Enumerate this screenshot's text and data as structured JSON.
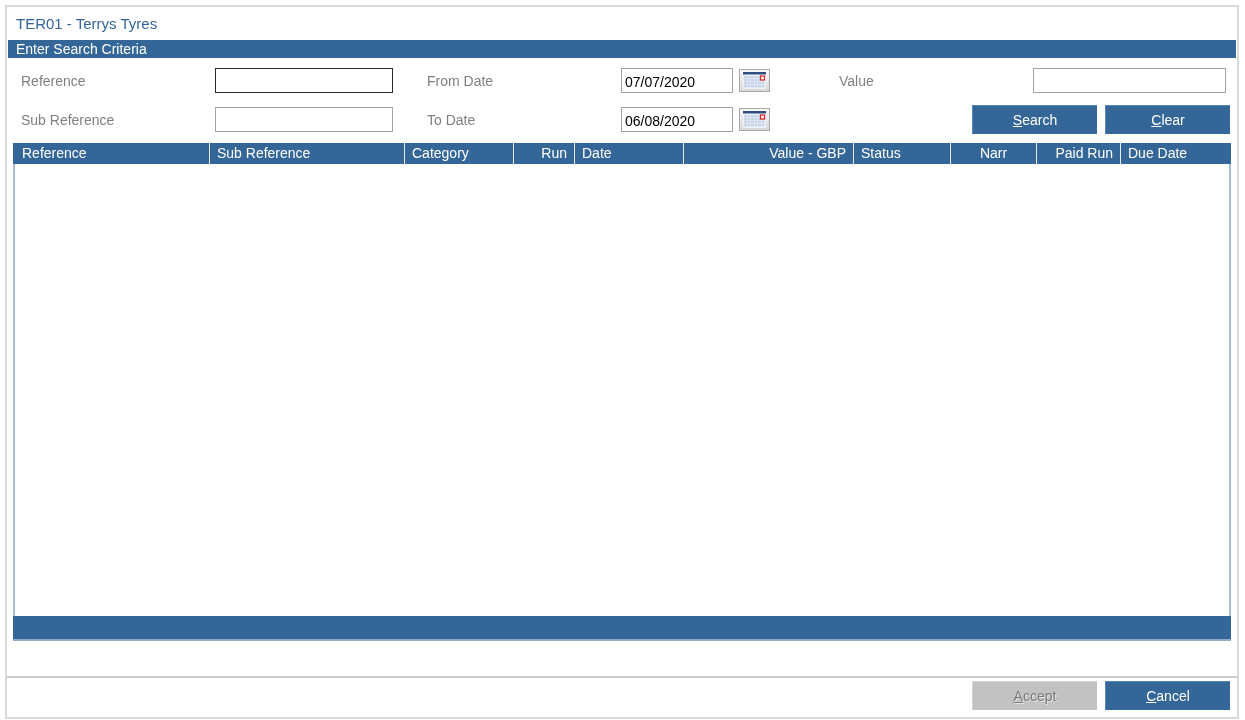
{
  "window": {
    "title": "TER01 - Terrys Tyres"
  },
  "search_criteria": {
    "heading": "Enter Search Criteria",
    "fields": [
      {
        "label": "Reference",
        "kind": "text",
        "focused": true
      },
      {
        "label": "From Date",
        "kind": "date",
        "value": "07/07/2020",
        "focused": false
      },
      {
        "label": "Value",
        "kind": "text",
        "focused": false
      },
      {
        "label": "Sub Reference",
        "kind": "text",
        "focused": false
      },
      {
        "label": "To Date",
        "kind": "date",
        "value": "06/08/2020",
        "focused": false
      }
    ],
    "buttons": [
      {
        "label": "Search",
        "access_key": true,
        "disabled": false
      },
      {
        "label": "Clear",
        "access_key": true,
        "disabled": false
      }
    ]
  },
  "results_table": {
    "columns": [
      {
        "label": "Reference"
      },
      {
        "label": "Sub Reference"
      },
      {
        "label": "Category"
      },
      {
        "label": "Run"
      },
      {
        "label": "Date"
      },
      {
        "label": "Value - GBP"
      },
      {
        "label": "Status"
      },
      {
        "label": "Narr"
      },
      {
        "label": "Paid Run"
      },
      {
        "label": "Due Date"
      }
    ]
  },
  "footer_buttons": [
    {
      "label": "Accept",
      "access_key": true,
      "disabled": true
    },
    {
      "label": "Cancel",
      "access_key": true,
      "disabled": false
    }
  ]
}
